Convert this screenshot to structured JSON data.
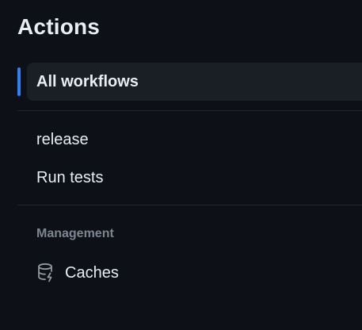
{
  "page": {
    "title": "Actions"
  },
  "workflows": {
    "all_label": "All workflows",
    "items": [
      {
        "label": "release"
      },
      {
        "label": "Run tests"
      }
    ]
  },
  "management": {
    "heading": "Management",
    "items": [
      {
        "label": "Caches",
        "icon": "database-icon"
      }
    ]
  },
  "colors": {
    "background": "#0d1117",
    "accent": "#2f81f7",
    "active_bg": "#1a1f26",
    "muted_text": "#7d8590"
  }
}
